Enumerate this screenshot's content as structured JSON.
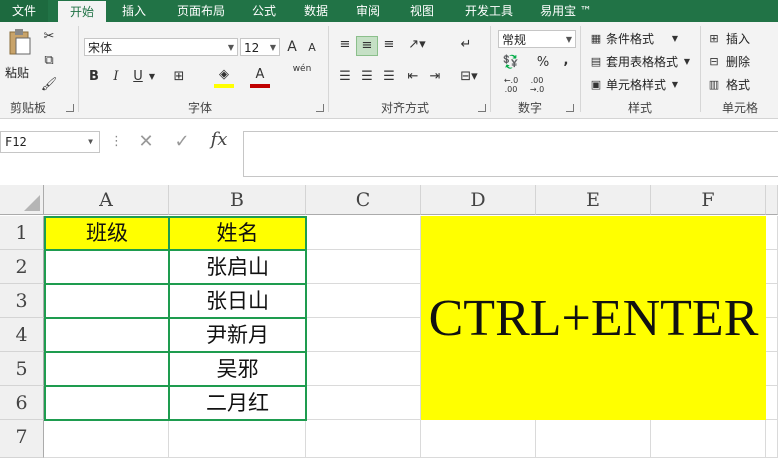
{
  "tabs": [
    "文件",
    "开始",
    "插入",
    "页面布局",
    "公式",
    "数据",
    "审阅",
    "视图",
    "开发工具",
    "易用宝 ™"
  ],
  "ribbon": {
    "clipboard": {
      "paste": "粘贴",
      "group": "剪贴板"
    },
    "font": {
      "name": "宋体",
      "size": "12",
      "group": "字体",
      "bold": "B",
      "italic": "I",
      "underline": "U",
      "grow": "A",
      "shrink": "A",
      "fontcolor": "A",
      "phonetic": "wén"
    },
    "align": {
      "group": "对齐方式"
    },
    "number": {
      "format": "常规",
      "percent": "%",
      "comma": ",",
      "group": "数字"
    },
    "styles": {
      "conditional": "条件格式",
      "table": "套用表格格式",
      "cell": "单元格样式",
      "group": "样式"
    },
    "cells": {
      "insert": "插入",
      "delete": "删除",
      "format": "格式",
      "group": "单元格"
    }
  },
  "formula_bar": {
    "name_box": "F12",
    "fx": "fx",
    "formula": ""
  },
  "columns": [
    "A",
    "B",
    "C",
    "D",
    "E",
    "F"
  ],
  "rows": [
    "1",
    "2",
    "3",
    "4",
    "5",
    "6",
    "7"
  ],
  "table": {
    "header": [
      "班级",
      "姓名"
    ],
    "names": [
      "张启山",
      "张日山",
      "尹新月",
      "吴邪",
      "二月红"
    ]
  },
  "banner_text": "CTRL+ENTER",
  "colors": {
    "excel_green": "#217346",
    "highlight": "#ffff00",
    "border_green": "#1e9c4f"
  }
}
